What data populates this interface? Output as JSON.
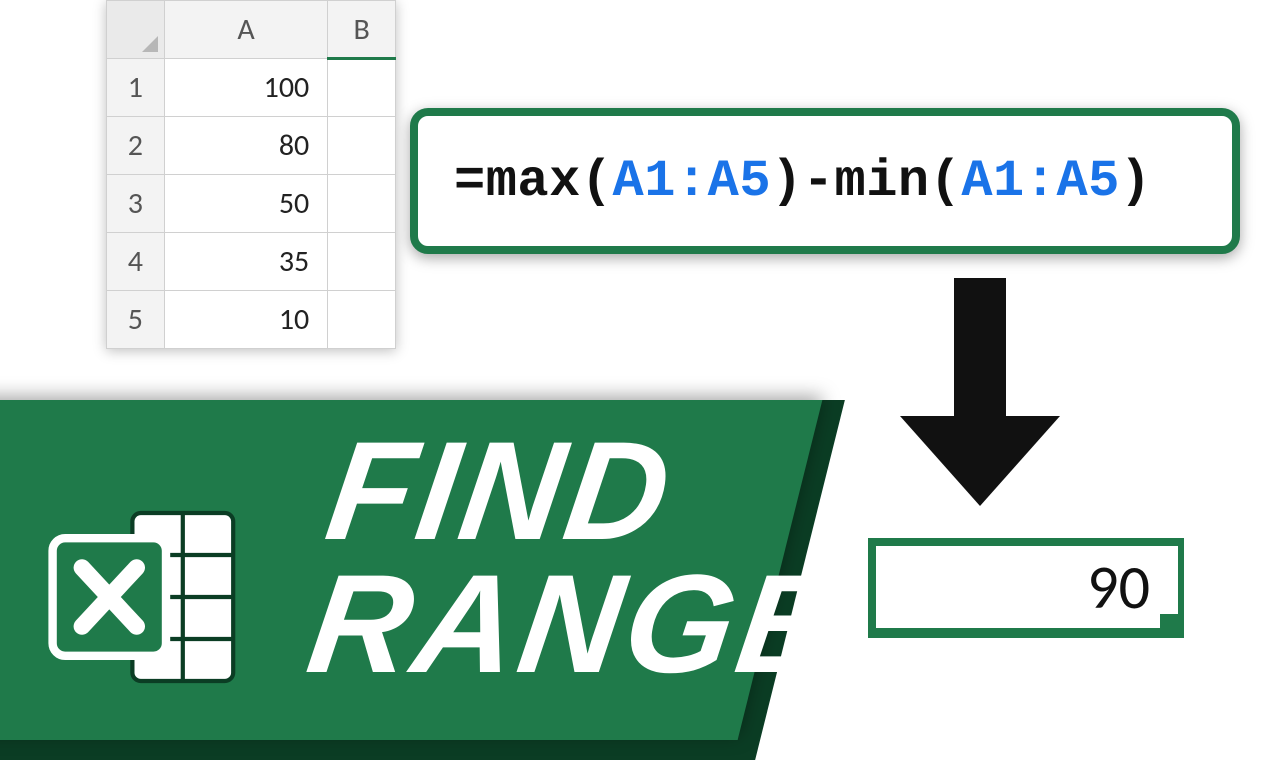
{
  "spreadsheet": {
    "columns": {
      "A": "A",
      "B": "B"
    },
    "rows": [
      {
        "n": "1",
        "a": "100"
      },
      {
        "n": "2",
        "a": "80"
      },
      {
        "n": "3",
        "a": "50"
      },
      {
        "n": "4",
        "a": "35"
      },
      {
        "n": "5",
        "a": "10"
      }
    ]
  },
  "formula": {
    "eq": "=",
    "fn1": "max(",
    "ref1": "A1:A5",
    "mid1": ")-",
    "fn2": "min(",
    "ref2": "A1:A5",
    "end": ")"
  },
  "result": {
    "value": "90"
  },
  "banner": {
    "line1": "FIND",
    "line2": "RANGE",
    "icon_name": "excel-icon"
  }
}
